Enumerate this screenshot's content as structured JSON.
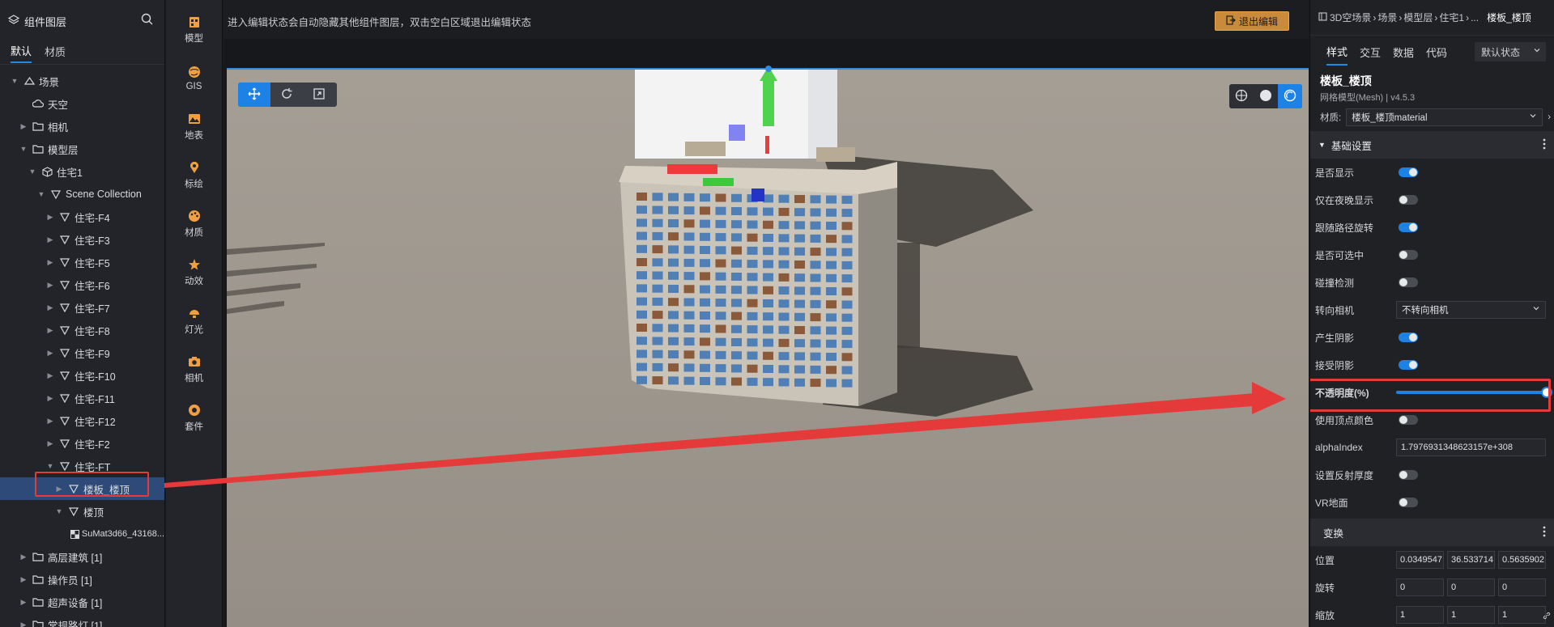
{
  "left_panel": {
    "title": "组件图层",
    "tabs": [
      {
        "label": "默认",
        "active": true
      },
      {
        "label": "材质",
        "active": false
      }
    ],
    "tree": [
      {
        "label": "场景",
        "depth": 0,
        "expanded": true,
        "icon": "scene-icon"
      },
      {
        "label": "天空",
        "depth": 1,
        "expanded": null,
        "icon": "cloud-icon"
      },
      {
        "label": "相机",
        "depth": 1,
        "expanded": false,
        "icon": "folder-icon"
      },
      {
        "label": "模型层",
        "depth": 1,
        "expanded": true,
        "icon": "folder-icon"
      },
      {
        "label": "住宅1",
        "depth": 2,
        "expanded": true,
        "icon": "cube-icon"
      },
      {
        "label": "Scene Collection",
        "depth": 3,
        "expanded": true,
        "icon": "mesh-icon"
      },
      {
        "label": "住宅-F4",
        "depth": 4,
        "expanded": false,
        "icon": "mesh-icon"
      },
      {
        "label": "住宅-F3",
        "depth": 4,
        "expanded": false,
        "icon": "mesh-icon"
      },
      {
        "label": "住宅-F5",
        "depth": 4,
        "expanded": false,
        "icon": "mesh-icon"
      },
      {
        "label": "住宅-F6",
        "depth": 4,
        "expanded": false,
        "icon": "mesh-icon"
      },
      {
        "label": "住宅-F7",
        "depth": 4,
        "expanded": false,
        "icon": "mesh-icon"
      },
      {
        "label": "住宅-F8",
        "depth": 4,
        "expanded": false,
        "icon": "mesh-icon"
      },
      {
        "label": "住宅-F9",
        "depth": 4,
        "expanded": false,
        "icon": "mesh-icon"
      },
      {
        "label": "住宅-F10",
        "depth": 4,
        "expanded": false,
        "icon": "mesh-icon"
      },
      {
        "label": "住宅-F11",
        "depth": 4,
        "expanded": false,
        "icon": "mesh-icon"
      },
      {
        "label": "住宅-F12",
        "depth": 4,
        "expanded": false,
        "icon": "mesh-icon"
      },
      {
        "label": "住宅-F2",
        "depth": 4,
        "expanded": false,
        "icon": "mesh-icon"
      },
      {
        "label": "住宅-FT",
        "depth": 4,
        "expanded": true,
        "icon": "mesh-icon"
      },
      {
        "label": "楼板_楼顶",
        "depth": 5,
        "expanded": false,
        "icon": "mesh-icon",
        "selected": true
      },
      {
        "label": "楼顶",
        "depth": 5,
        "expanded": true,
        "icon": "mesh-icon"
      },
      {
        "label": "SuMat3d66_43168...",
        "depth": 6,
        "expanded": null,
        "icon": "material-icon"
      },
      {
        "label": "高层建筑 [1]",
        "depth": 1,
        "expanded": false,
        "icon": "folder-icon"
      },
      {
        "label": "操作员 [1]",
        "depth": 1,
        "expanded": false,
        "icon": "folder-icon"
      },
      {
        "label": "超声设备 [1]",
        "depth": 1,
        "expanded": false,
        "icon": "folder-icon"
      },
      {
        "label": "常规路灯 [1]",
        "depth": 1,
        "expanded": false,
        "icon": "folder-icon"
      }
    ]
  },
  "tools": [
    {
      "label": "模型",
      "icon": "model-icon",
      "color": "#f0a040"
    },
    {
      "label": "GIS",
      "icon": "globe-icon",
      "color": "#f0a040"
    },
    {
      "label": "地表",
      "icon": "terrain-icon",
      "color": "#f0a040"
    },
    {
      "label": "标绘",
      "icon": "pin-icon",
      "color": "#f0a040"
    },
    {
      "label": "材质",
      "icon": "palette-icon",
      "color": "#f0a040"
    },
    {
      "label": "动效",
      "icon": "effect-icon",
      "color": "#f0a040"
    },
    {
      "label": "灯光",
      "icon": "light-icon",
      "color": "#f0a040"
    },
    {
      "label": "相机",
      "icon": "camera-icon",
      "color": "#f0a040"
    },
    {
      "label": "套件",
      "icon": "kit-icon",
      "color": "#f0a040"
    }
  ],
  "viewport": {
    "hint": "进入编辑状态会自动隐藏其他组件图层，双击空白区域退出编辑状态",
    "exit_label": "退出编辑"
  },
  "right_panel": {
    "breadcrumb": [
      "3D空场景",
      "场景",
      "模型层",
      "住宅1",
      "..."
    ],
    "breadcrumb_current": "楼板_楼顶",
    "tabs": [
      {
        "label": "样式",
        "active": true
      },
      {
        "label": "交互",
        "active": false
      },
      {
        "label": "数据",
        "active": false
      },
      {
        "label": "代码",
        "active": false
      }
    ],
    "state_select": "默认状态",
    "component_name": "楼板_楼顶",
    "component_type": "网格模型(Mesh) | v4.5.3",
    "material_label": "材质:",
    "material_value": "楼板_楼顶material",
    "basic_section": "基础设置",
    "props": [
      {
        "label": "是否显示",
        "type": "toggle",
        "on": true
      },
      {
        "label": "仅在夜晚显示",
        "type": "toggle",
        "on": false
      },
      {
        "label": "跟随路径旋转",
        "type": "toggle",
        "on": true
      },
      {
        "label": "是否可选中",
        "type": "toggle",
        "on": false
      },
      {
        "label": "碰撞检测",
        "type": "toggle",
        "on": false
      },
      {
        "label": "转向相机",
        "type": "select",
        "value": "不转向相机"
      },
      {
        "label": "产生阴影",
        "type": "toggle",
        "on": true
      },
      {
        "label": "接受阴影",
        "type": "toggle",
        "on": true
      },
      {
        "label": "不透明度(%)",
        "type": "slider",
        "value": 100
      },
      {
        "label": "使用顶点颜色",
        "type": "toggle",
        "on": false
      },
      {
        "label": "alphaIndex",
        "type": "input",
        "value": "1.7976931348623157e+308"
      },
      {
        "label": "设置反射厚度",
        "type": "toggle",
        "on": false
      },
      {
        "label": "VR地面",
        "type": "toggle",
        "on": false
      }
    ],
    "transform_section": "变换",
    "transform": [
      {
        "label": "位置",
        "values": [
          "0.0349547",
          "36.533714",
          "0.5635902"
        ]
      },
      {
        "label": "旋转",
        "values": [
          "0",
          "0",
          "0"
        ]
      },
      {
        "label": "缩放",
        "values": [
          "1",
          "1",
          "1"
        ]
      }
    ]
  },
  "colors": {
    "accent": "#1d82e6",
    "annotation": "#e53a3a",
    "exit_button": "#c98a3a"
  }
}
